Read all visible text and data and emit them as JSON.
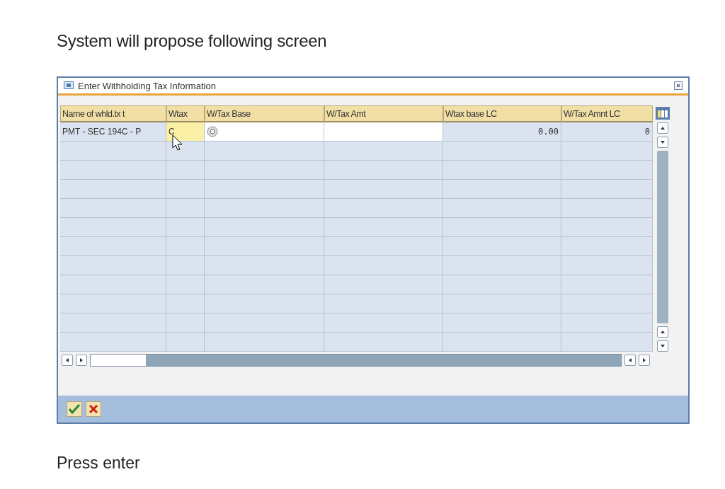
{
  "heading": "System will propose following screen",
  "dialog": {
    "title": "Enter Withholding Tax Information",
    "table": {
      "columns": [
        "Name of whld.tx t",
        "Wtax",
        "W/Tax Base",
        "W/Tax Amt",
        "Wtax base LC",
        "W/Tax Amnt LC"
      ],
      "rows": [
        {
          "cells": [
            {
              "kind": "display",
              "text": "PMT - SEC 194C - P"
            },
            {
              "kind": "focus",
              "text": "C"
            },
            {
              "kind": "input_help"
            },
            {
              "kind": "input"
            },
            {
              "kind": "amount",
              "text": "0.00"
            },
            {
              "kind": "amount",
              "text": "0"
            }
          ]
        }
      ]
    },
    "buttons": [
      {
        "kind": "confirm"
      },
      {
        "kind": "cancel"
      }
    ]
  },
  "footer": "Press enter"
}
